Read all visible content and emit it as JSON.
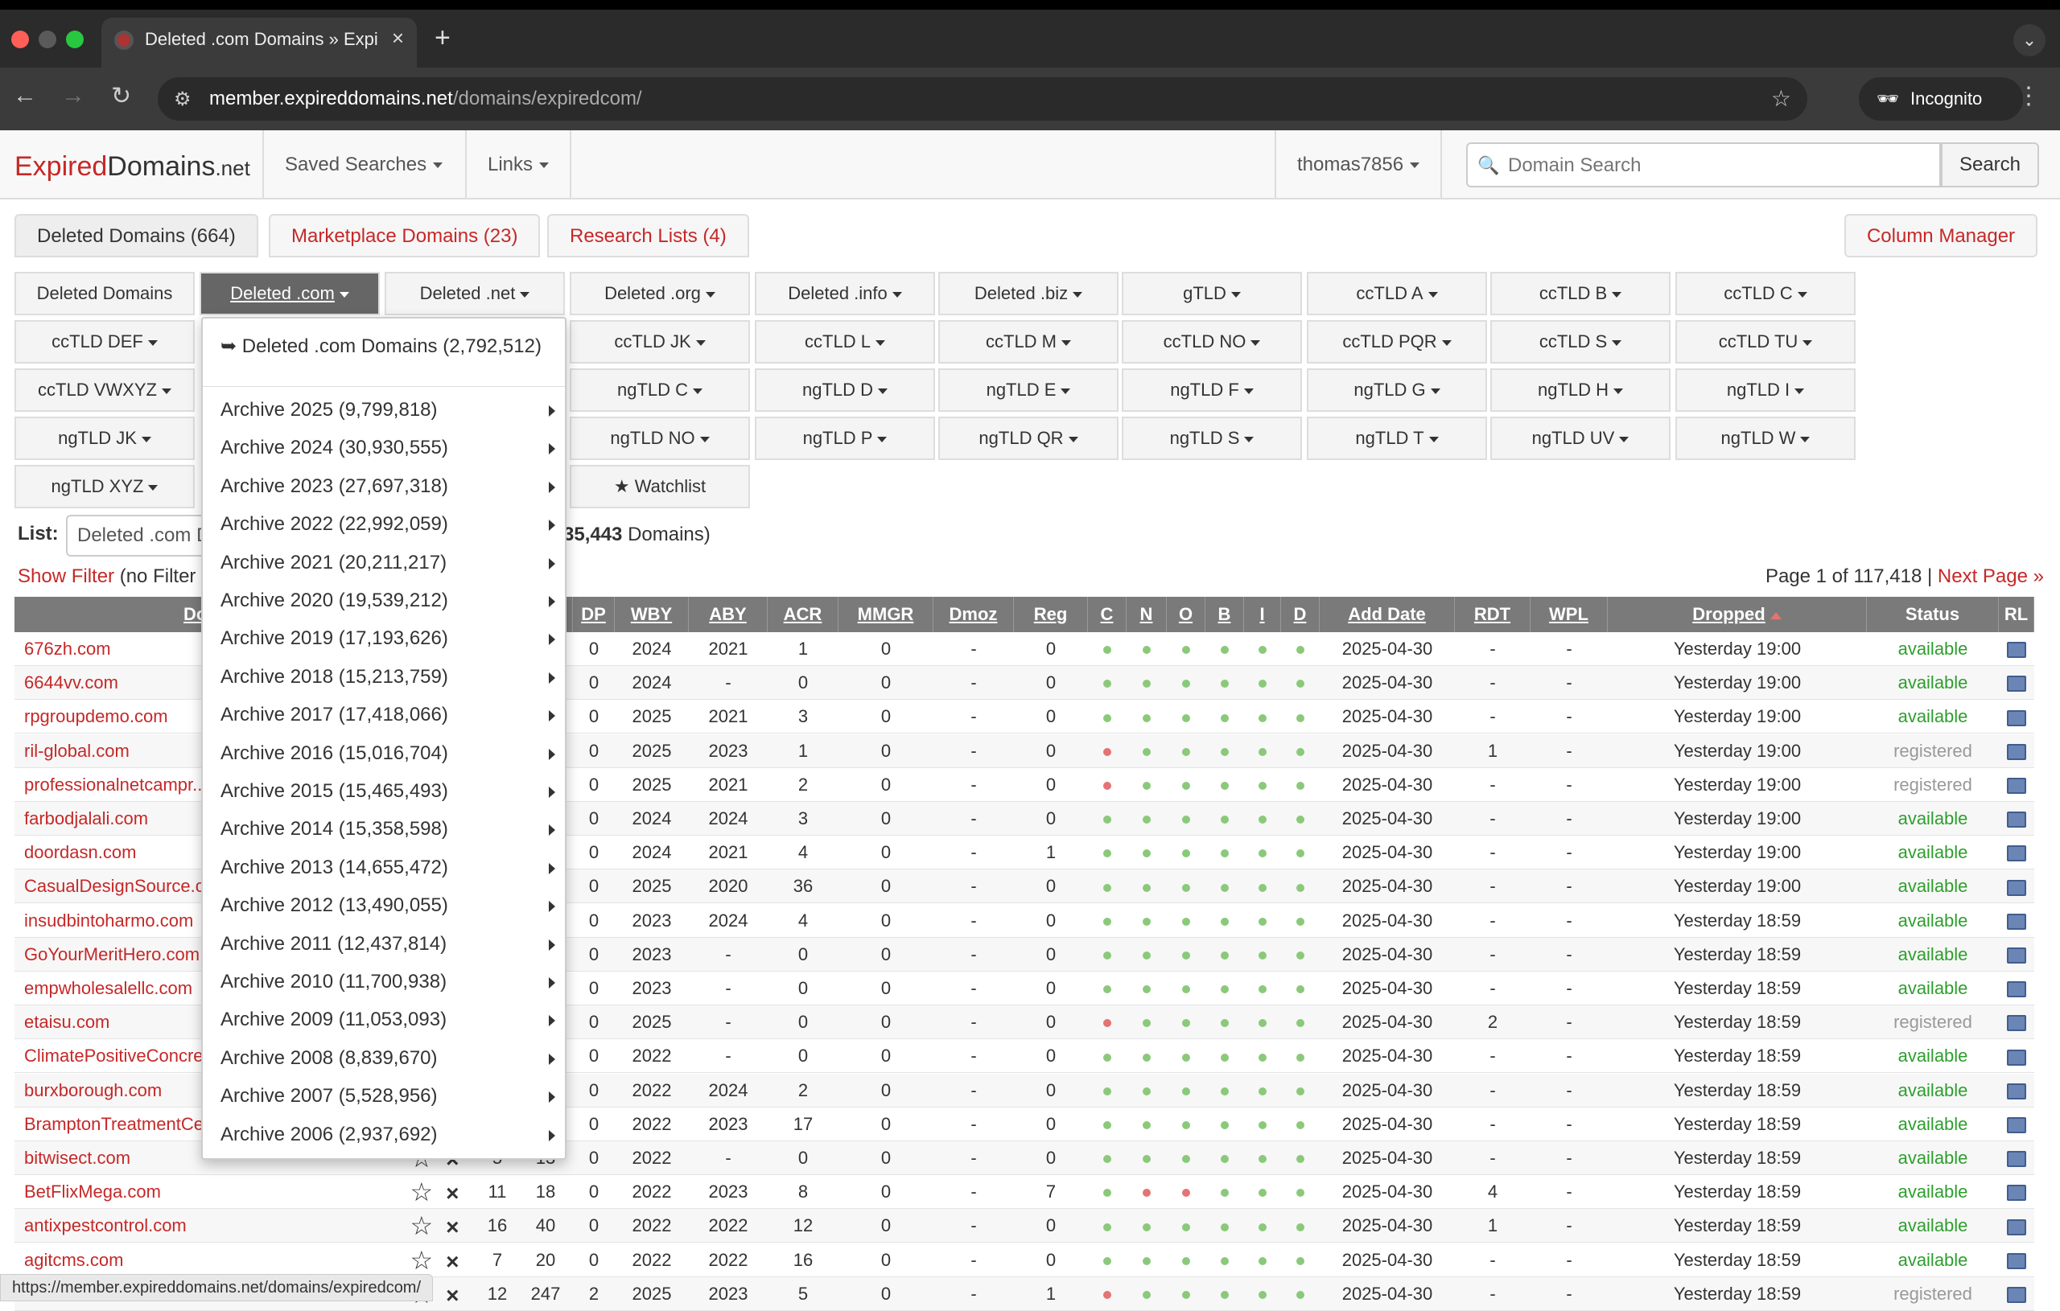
{
  "browser": {
    "tab_title": "Deleted .com Domains » Expi",
    "url_host": "member.expireddomains.net",
    "url_path": "/domains/expiredcom/",
    "incognito_label": "Incognito"
  },
  "site": {
    "brand_a": "Expired",
    "brand_b": "Domains",
    "brand_c": ".net",
    "nav": {
      "saved_searches": "Saved Searches",
      "links": "Links",
      "user": "thomas7856"
    },
    "search": {
      "placeholder": "Domain Search",
      "button": "Search"
    }
  },
  "main_tabs": [
    {
      "label": "Deleted Domains (664)"
    },
    {
      "label": "Marketplace Domains (23)"
    },
    {
      "label": "Research Lists (4)"
    }
  ],
  "column_manager": "Column Manager",
  "tld_rows": [
    [
      "Deleted Domains",
      "Deleted .com",
      "Deleted .net",
      "Deleted .org",
      "Deleted .info",
      "Deleted .biz",
      "gTLD",
      "ccTLD A",
      "ccTLD B",
      "ccTLD C"
    ],
    [
      "ccTLD DEF",
      "",
      "ccTLD JK",
      "ccTLD L",
      "ccTLD M",
      "ccTLD NO",
      "ccTLD PQR",
      "ccTLD S",
      "ccTLD TU"
    ],
    [
      "ccTLD VWXYZ",
      "",
      "ngTLD C",
      "ngTLD D",
      "ngTLD E",
      "ngTLD F",
      "ngTLD G",
      "ngTLD H",
      "ngTLD I"
    ],
    [
      "ngTLD JK",
      "",
      "ngTLD NO",
      "ngTLD P",
      "ngTLD QR",
      "ngTLD S",
      "ngTLD T",
      "ngTLD UV",
      "ngTLD W"
    ],
    [
      "ngTLD XYZ",
      "",
      "Watchlist"
    ]
  ],
  "list": {
    "label": "List:",
    "selected": "Deleted .com Domains",
    "count_prefix": "35,443",
    "count_suffix": "Domains)"
  },
  "filter": {
    "show_filter": "Show Filter",
    "no_filter": "(no Filter"
  },
  "pager": {
    "text": "Page 1 of 117,418 |",
    "next": "Next Page »"
  },
  "dropdown": {
    "header": "➥ Deleted .com Domains (2,792,512)",
    "items": [
      "Archive 2025 (9,799,818)",
      "Archive 2024 (30,930,555)",
      "Archive 2023 (27,697,318)",
      "Archive 2022 (22,992,059)",
      "Archive 2021 (20,211,217)",
      "Archive 2020 (19,539,212)",
      "Archive 2019 (17,193,626)",
      "Archive 2018 (15,213,759)",
      "Archive 2017 (17,418,066)",
      "Archive 2016 (15,016,704)",
      "Archive 2015 (15,465,493)",
      "Archive 2014 (15,358,598)",
      "Archive 2013 (14,655,472)",
      "Archive 2012 (13,490,055)",
      "Archive 2011 (12,437,814)",
      "Archive 2010 (11,700,938)",
      "Archive 2009 (11,053,093)",
      "Archive 2008 (8,839,670)",
      "Archive 2007 (5,528,956)",
      "Archive 2006 (2,937,692)"
    ]
  },
  "table": {
    "headers": [
      "Dom",
      "DP",
      "WBY",
      "ABY",
      "ACR",
      "MMGR",
      "Dmoz",
      "Reg",
      "C",
      "N",
      "O",
      "B",
      "I",
      "D",
      "Add Date",
      "RDT",
      "WPL",
      "Dropped",
      "Status",
      "RL"
    ],
    "rows": [
      {
        "domain": "676zh.com",
        "bl": "",
        "dp": "0",
        "wby": "2024",
        "aby": "2021",
        "acr": "1",
        "mmgr": "0",
        "dmoz": "-",
        "reg": "0",
        "dots": [
          0,
          0,
          0,
          0,
          0,
          0
        ],
        "add": "2025-04-30",
        "rdt": "-",
        "wpl": "-",
        "dropped": "Yesterday 19:00",
        "status": "available"
      },
      {
        "domain": "6644vv.com",
        "bl": "",
        "dp": "0",
        "wby": "2024",
        "aby": "-",
        "acr": "0",
        "mmgr": "0",
        "dmoz": "-",
        "reg": "0",
        "dots": [
          0,
          0,
          0,
          0,
          0,
          0
        ],
        "add": "2025-04-30",
        "rdt": "-",
        "wpl": "-",
        "dropped": "Yesterday 19:00",
        "status": "available"
      },
      {
        "domain": "rpgroupdemo.com",
        "bl": "",
        "dp": "0",
        "wby": "2025",
        "aby": "2021",
        "acr": "3",
        "mmgr": "0",
        "dmoz": "-",
        "reg": "0",
        "dots": [
          0,
          0,
          0,
          0,
          0,
          0
        ],
        "add": "2025-04-30",
        "rdt": "-",
        "wpl": "-",
        "dropped": "Yesterday 19:00",
        "status": "available"
      },
      {
        "domain": "ril-global.com",
        "bl": "",
        "dp": "0",
        "wby": "2025",
        "aby": "2023",
        "acr": "1",
        "mmgr": "0",
        "dmoz": "-",
        "reg": "0",
        "dots": [
          1,
          0,
          0,
          0,
          0,
          0
        ],
        "add": "2025-04-30",
        "rdt": "1",
        "wpl": "-",
        "dropped": "Yesterday 19:00",
        "status": "registered"
      },
      {
        "domain": "professionalnetcampr...",
        "bl": "",
        "dp": "0",
        "wby": "2025",
        "aby": "2021",
        "acr": "2",
        "mmgr": "0",
        "dmoz": "-",
        "reg": "0",
        "dots": [
          1,
          0,
          0,
          0,
          0,
          0
        ],
        "add": "2025-04-30",
        "rdt": "-",
        "wpl": "-",
        "dropped": "Yesterday 19:00",
        "status": "registered"
      },
      {
        "domain": "farbodjalali.com",
        "bl": "",
        "dp": "0",
        "wby": "2024",
        "aby": "2024",
        "acr": "3",
        "mmgr": "0",
        "dmoz": "-",
        "reg": "0",
        "dots": [
          0,
          0,
          0,
          0,
          0,
          0
        ],
        "add": "2025-04-30",
        "rdt": "-",
        "wpl": "-",
        "dropped": "Yesterday 19:00",
        "status": "available"
      },
      {
        "domain": "doordasn.com",
        "bl": "",
        "dp": "0",
        "wby": "2024",
        "aby": "2021",
        "acr": "4",
        "mmgr": "0",
        "dmoz": "-",
        "reg": "1",
        "dots": [
          0,
          0,
          0,
          0,
          0,
          0
        ],
        "add": "2025-04-30",
        "rdt": "-",
        "wpl": "-",
        "dropped": "Yesterday 19:00",
        "status": "available"
      },
      {
        "domain": "CasualDesignSource.c...",
        "bl": "",
        "dp": "0",
        "wby": "2025",
        "aby": "2020",
        "acr": "36",
        "mmgr": "0",
        "dmoz": "-",
        "reg": "0",
        "dots": [
          0,
          0,
          0,
          0,
          0,
          0
        ],
        "add": "2025-04-30",
        "rdt": "-",
        "wpl": "-",
        "dropped": "Yesterday 19:00",
        "status": "available"
      },
      {
        "domain": "insudbintoharmo.com",
        "bl": "",
        "dp": "0",
        "wby": "2023",
        "aby": "2024",
        "acr": "4",
        "mmgr": "0",
        "dmoz": "-",
        "reg": "0",
        "dots": [
          0,
          0,
          0,
          0,
          0,
          0
        ],
        "add": "2025-04-30",
        "rdt": "-",
        "wpl": "-",
        "dropped": "Yesterday 18:59",
        "status": "available"
      },
      {
        "domain": "GoYourMeritHero.com",
        "bl": "",
        "dp": "0",
        "wby": "2023",
        "aby": "-",
        "acr": "0",
        "mmgr": "0",
        "dmoz": "-",
        "reg": "0",
        "dots": [
          0,
          0,
          0,
          0,
          0,
          0
        ],
        "add": "2025-04-30",
        "rdt": "-",
        "wpl": "-",
        "dropped": "Yesterday 18:59",
        "status": "available"
      },
      {
        "domain": "empwholesalellc.com",
        "bl": "",
        "dp": "0",
        "wby": "2023",
        "aby": "-",
        "acr": "0",
        "mmgr": "0",
        "dmoz": "-",
        "reg": "0",
        "dots": [
          0,
          0,
          0,
          0,
          0,
          0
        ],
        "add": "2025-04-30",
        "rdt": "-",
        "wpl": "-",
        "dropped": "Yesterday 18:59",
        "status": "available"
      },
      {
        "domain": "etaisu.com",
        "bl": "",
        "dp": "0",
        "wby": "2025",
        "aby": "-",
        "acr": "0",
        "mmgr": "0",
        "dmoz": "-",
        "reg": "0",
        "dots": [
          1,
          0,
          0,
          0,
          0,
          0
        ],
        "add": "2025-04-30",
        "rdt": "2",
        "wpl": "-",
        "dropped": "Yesterday 18:59",
        "status": "registered"
      },
      {
        "domain": "ClimatePositiveConcre...",
        "bl": "",
        "dp": "0",
        "wby": "2022",
        "aby": "-",
        "acr": "0",
        "mmgr": "0",
        "dmoz": "-",
        "reg": "0",
        "dots": [
          0,
          0,
          0,
          0,
          0,
          0
        ],
        "add": "2025-04-30",
        "rdt": "-",
        "wpl": "-",
        "dropped": "Yesterday 18:59",
        "status": "available"
      },
      {
        "domain": "burxborough.com",
        "bl": "",
        "dp": "0",
        "wby": "2022",
        "aby": "2024",
        "acr": "2",
        "mmgr": "0",
        "dmoz": "-",
        "reg": "0",
        "dots": [
          0,
          0,
          0,
          0,
          0,
          0
        ],
        "add": "2025-04-30",
        "rdt": "-",
        "wpl": "-",
        "dropped": "Yesterday 18:59",
        "status": "available"
      },
      {
        "domain": "BramptonTreatmentCe...",
        "bl": "",
        "dp": "0",
        "wby": "2022",
        "aby": "2023",
        "acr": "17",
        "mmgr": "0",
        "dmoz": "-",
        "reg": "0",
        "dots": [
          0,
          0,
          0,
          0,
          0,
          0
        ],
        "add": "2025-04-30",
        "rdt": "-",
        "wpl": "-",
        "dropped": "Yesterday 18:59",
        "status": "available"
      },
      {
        "domain": "bitwisect.com",
        "bl": "5",
        "cblb": "13",
        "dp": "0",
        "wby": "2022",
        "aby": "-",
        "acr": "0",
        "mmgr": "0",
        "dmoz": "-",
        "reg": "0",
        "dots": [
          0,
          0,
          0,
          0,
          0,
          0
        ],
        "add": "2025-04-30",
        "rdt": "-",
        "wpl": "-",
        "dropped": "Yesterday 18:59",
        "status": "available"
      },
      {
        "domain": "BetFlixMega.com",
        "bl": "11",
        "cblb": "18",
        "dp": "0",
        "wby": "2022",
        "aby": "2023",
        "acr": "8",
        "mmgr": "0",
        "dmoz": "-",
        "reg": "7",
        "dots": [
          0,
          1,
          1,
          0,
          0,
          0
        ],
        "add": "2025-04-30",
        "rdt": "4",
        "wpl": "-",
        "dropped": "Yesterday 18:59",
        "status": "available"
      },
      {
        "domain": "antixpestcontrol.com",
        "bl": "16",
        "cblb": "40",
        "dp": "0",
        "wby": "2022",
        "aby": "2022",
        "acr": "12",
        "mmgr": "0",
        "dmoz": "-",
        "reg": "0",
        "dots": [
          0,
          0,
          0,
          0,
          0,
          0
        ],
        "add": "2025-04-30",
        "rdt": "1",
        "wpl": "-",
        "dropped": "Yesterday 18:59",
        "status": "available"
      },
      {
        "domain": "agitcms.com",
        "bl": "7",
        "cblb": "20",
        "dp": "0",
        "wby": "2022",
        "aby": "2022",
        "acr": "16",
        "mmgr": "0",
        "dmoz": "-",
        "reg": "0",
        "dots": [
          0,
          0,
          0,
          0,
          0,
          0
        ],
        "add": "2025-04-30",
        "rdt": "-",
        "wpl": "-",
        "dropped": "Yesterday 18:59",
        "status": "available"
      },
      {
        "domain": "",
        "bl": "12",
        "cblb": "247",
        "dp": "2",
        "wby": "2025",
        "aby": "2023",
        "acr": "5",
        "mmgr": "0",
        "dmoz": "-",
        "reg": "1",
        "dots": [
          1,
          0,
          0,
          0,
          0,
          0
        ],
        "add": "2025-04-30",
        "rdt": "-",
        "wpl": "-",
        "dropped": "Yesterday 18:59",
        "status": "registered"
      }
    ]
  },
  "status_bar_url": "https://member.expireddomains.net/domains/expiredcom/",
  "colors": {
    "accent": "#c62828",
    "available": "#2e9e2e",
    "registered": "#999999",
    "dot_green": "#8bc97a",
    "dot_red": "#e57373"
  }
}
